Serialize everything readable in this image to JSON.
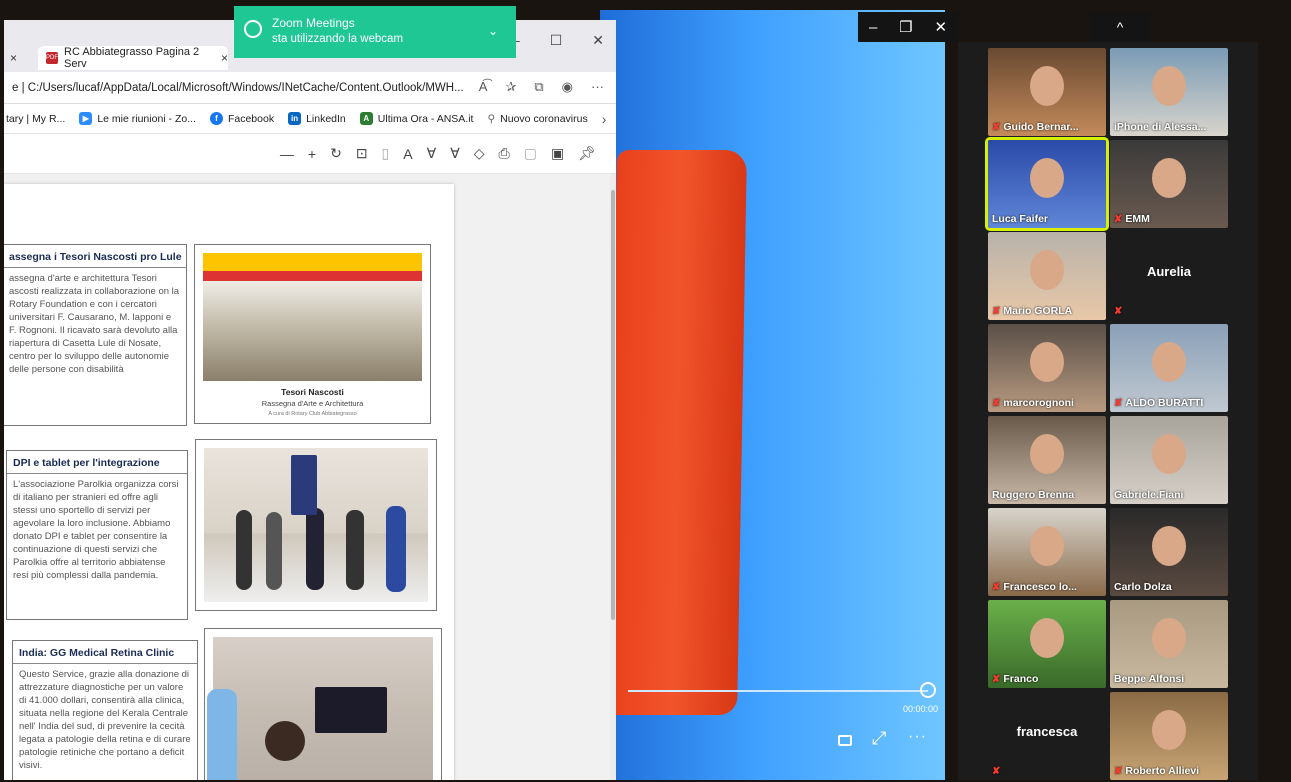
{
  "browser": {
    "tabs": [
      {
        "label": "",
        "close": "×"
      },
      {
        "label": "RC Abbiategrasso Pagina 2 Serv",
        "close": "×"
      }
    ],
    "address": "e  |  C:/Users/lucaf/AppData/Local/Microsoft/Windows/INetCache/Content.Outlook/MWH...",
    "favorites": [
      {
        "label": "tary | My R...",
        "icon": "rotary-icon",
        "color": "#ffffff"
      },
      {
        "label": "Le mie riunioni - Zo...",
        "icon": "zoom-icon",
        "color": "#2d8cff"
      },
      {
        "label": "Facebook",
        "icon": "facebook-icon",
        "color": "#1877f2"
      },
      {
        "label": "LinkedIn",
        "icon": "linkedin-icon",
        "color": "#0a66c2"
      },
      {
        "label": "Ultima Ora - ANSA.it",
        "icon": "ansa-icon",
        "color": "#2e7d32"
      },
      {
        "label": "Nuovo coronavirus",
        "icon": "search-icon",
        "color": "#ffffff"
      }
    ],
    "window_controls": [
      "—",
      "☐",
      "✕"
    ]
  },
  "toast": {
    "title": "Zoom Meetings",
    "message": "sta utilizzando la webcam",
    "color": "#1fc795"
  },
  "pdf": {
    "items": [
      {
        "title": "assegna i Tesori Nascosti pro Lule",
        "body": "assegna d'arte e architettura Tesori ascosti realizzata in collaborazione on la Rotary Foundation e con i cercatori universitari F. Causarano, M. lapponi e F. Rognoni. Il ricavato sarà devoluto alla riapertura di Casetta Lule di Nosate, centro per lo sviluppo delle autonomie delle persone con disabilità",
        "caption_title": "Tesori Nascosti",
        "caption_sub": "Rassegna d'Arte e Architettura",
        "caption_small": "A cura di Rotary Club Abbiategrasso"
      },
      {
        "title": "DPI e tablet per l'integrazione",
        "body": "L'associazione Parolkia organizza corsi di italiano per stranieri ed offre agli stessi uno sportello di servizi per agevolare la loro inclusione. Abbiamo donato DPI e tablet per consentire la continuazione di questi servizi che Parolkia offre al territorio abbiatense resi più complessi dalla pandemia."
      },
      {
        "title": "India: GG Medical Retina Clinic",
        "body": "Questo Service, grazie alla donazione di attrezzature diagnostiche per un valore di 41.000 dollari, consentirà alla clinica, situata nella regione del Kerala Centrale nell' India del sud, di prevenire la cecità legata a patologie della retina e di curare patologie retiniche che portano a deficit visivi."
      }
    ]
  },
  "zoom": {
    "timestamp": "00:00:00",
    "gallery_collapse": "^",
    "participants": [
      {
        "name": "Guido Bernar...",
        "muted": true
      },
      {
        "name": "iPhone di Alessa...",
        "muted": false
      },
      {
        "name": "Luca Faifer",
        "muted": false,
        "active": true
      },
      {
        "name": "EMM",
        "muted": true
      },
      {
        "name": "Mario GORLA",
        "muted": true
      },
      {
        "name": "Aurelia",
        "muted": true,
        "video_off": true
      },
      {
        "name": "marcorognoni",
        "muted": true
      },
      {
        "name": "ALDO BURATTI",
        "muted": true
      },
      {
        "name": "Ruggero Brenna",
        "muted": false
      },
      {
        "name": "Gabriele.Fiani",
        "muted": false
      },
      {
        "name": "Francesco lo...",
        "muted": true
      },
      {
        "name": "Carlo Dolza",
        "muted": false
      },
      {
        "name": "Franco",
        "muted": true
      },
      {
        "name": "Beppe Alfonsi",
        "muted": false
      },
      {
        "name": "francesca",
        "muted": true,
        "video_off": true
      },
      {
        "name": "Roberto Allievi",
        "muted": true
      }
    ]
  }
}
